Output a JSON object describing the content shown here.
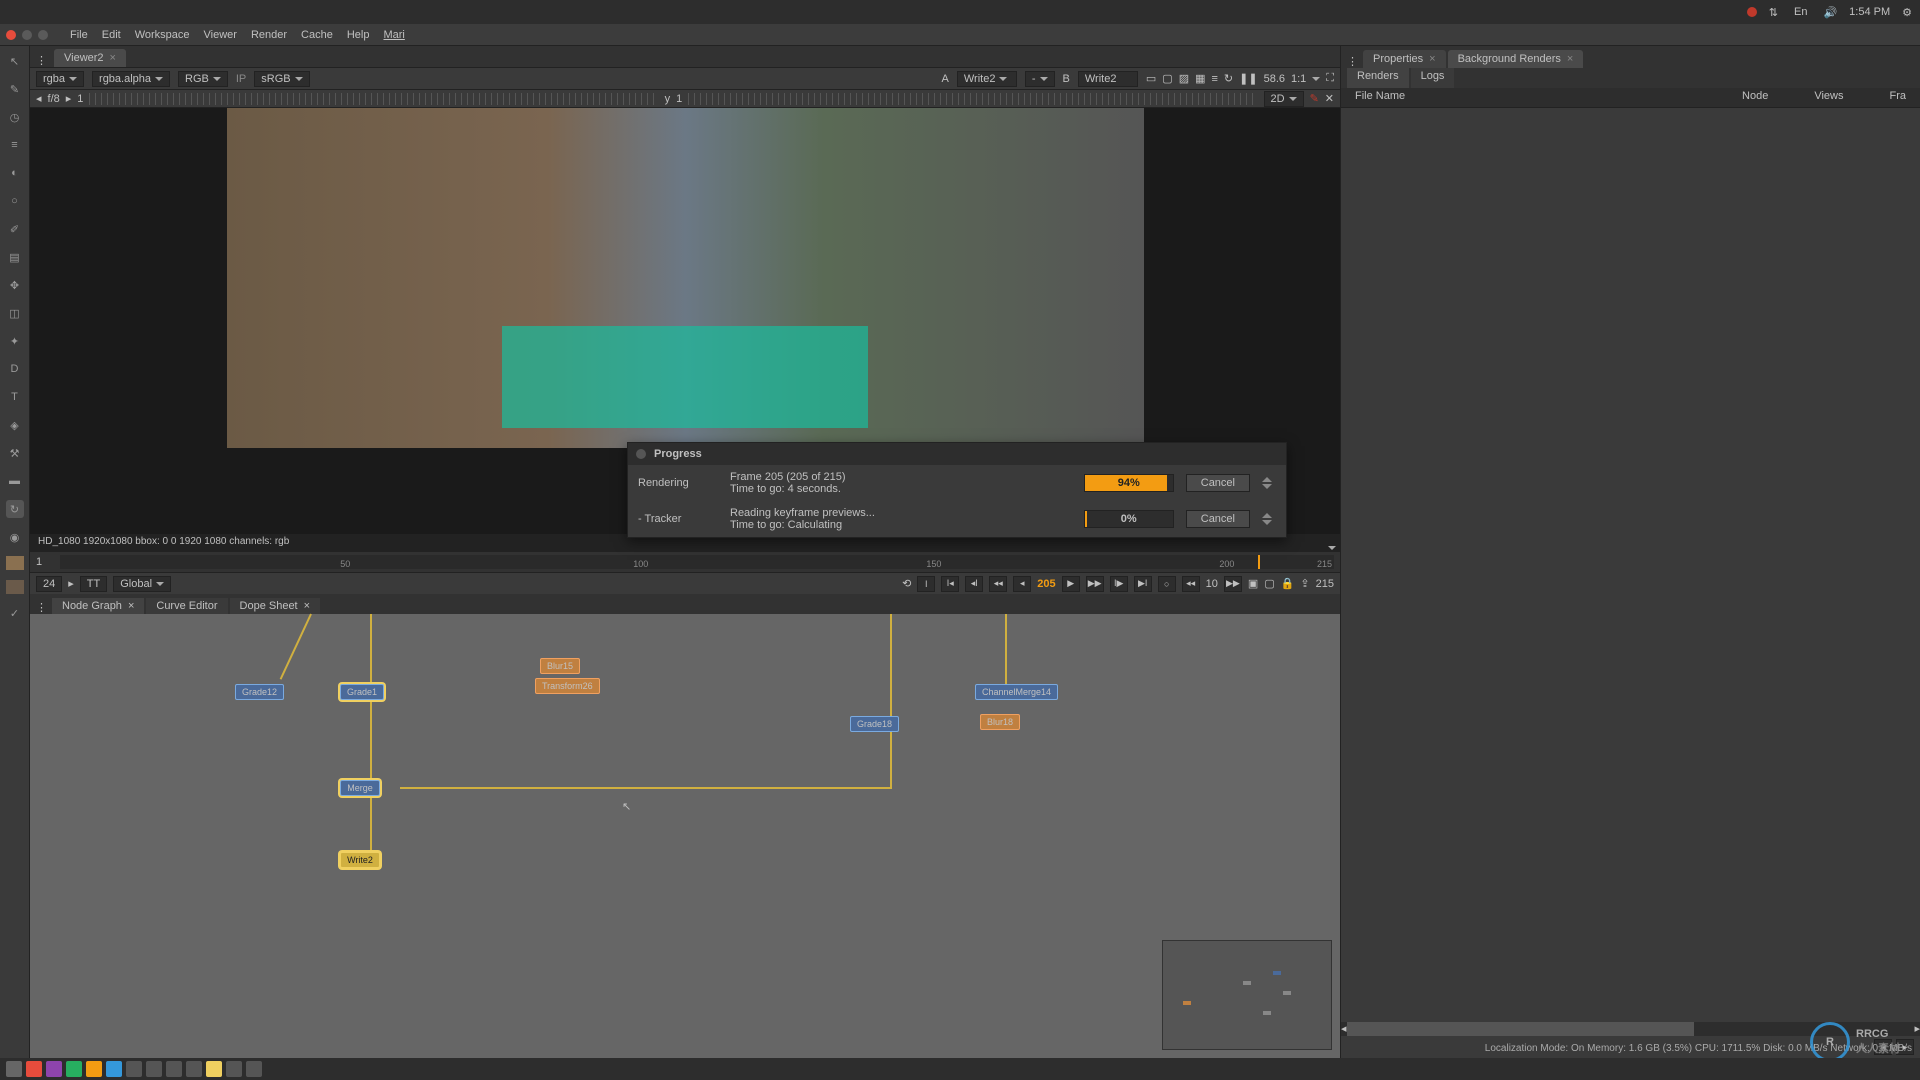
{
  "os": {
    "time": "1:54 PM",
    "lang": "En"
  },
  "menu": [
    "File",
    "Edit",
    "Workspace",
    "Viewer",
    "Render",
    "Cache",
    "Help",
    "Mari"
  ],
  "viewer": {
    "tab": "Viewer2",
    "ch1": "rgba",
    "ch2": "rgba.alpha",
    "ch3": "RGB",
    "ip": "IP",
    "cs": "sRGB",
    "a_label": "A",
    "a_val": "Write2",
    "b_label": "B",
    "b_val": "Write2",
    "zoom": "58.6",
    "scale": "1:1",
    "f_label": "f/8",
    "f_val": "1",
    "y_label": "y",
    "y_val": "1",
    "mode2d": "2D",
    "info": "HD_1080 1920x1080  bbox: 0 0 1920 1080 channels: rgb"
  },
  "timeline": {
    "fr1": "1",
    "m50": "50",
    "m100": "100",
    "m150": "150",
    "m200": "200",
    "m215": "215",
    "fps": "24",
    "tt": "TT",
    "global": "Global",
    "frame": "205",
    "step": "10",
    "end": "215"
  },
  "ng_tabs": [
    "Node Graph",
    "Curve Editor",
    "Dope Sheet"
  ],
  "nodes": {
    "n1": "Grade12",
    "n2": "Grade1",
    "n3": "Blur15",
    "n4": "Transform26",
    "n5": "Merge",
    "n6": "Grade18",
    "n7": "ChannelMerge14",
    "n8": "Blur18",
    "n9": "Write2"
  },
  "right": {
    "tab1": "Properties",
    "tab2": "Background Renders",
    "sub1": "Renders",
    "sub2": "Logs",
    "h1": "File Name",
    "h2": "Node",
    "h3": "Views",
    "h4": "Fra"
  },
  "progress": {
    "title": "Progress",
    "task1": "Rendering",
    "t1_info1": "Frame 205 (205 of 215)",
    "t1_info2": "Time to go: 4 seconds.",
    "t1_pct": "94%",
    "task2": "- Tracker",
    "t2_info1": "Reading keyframe previews...",
    "t2_info2": "Time to go: Calculating",
    "t2_pct": "0%",
    "cancel": "Cancel"
  },
  "status": "Localization Mode: On  Memory: 1.6 GB (3.5%)  CPU: 1711.5%  Disk: 0.0 MB/s  Network: 0.0 MB/s",
  "logo": "RRCG",
  "logo_sub": "人人素材"
}
